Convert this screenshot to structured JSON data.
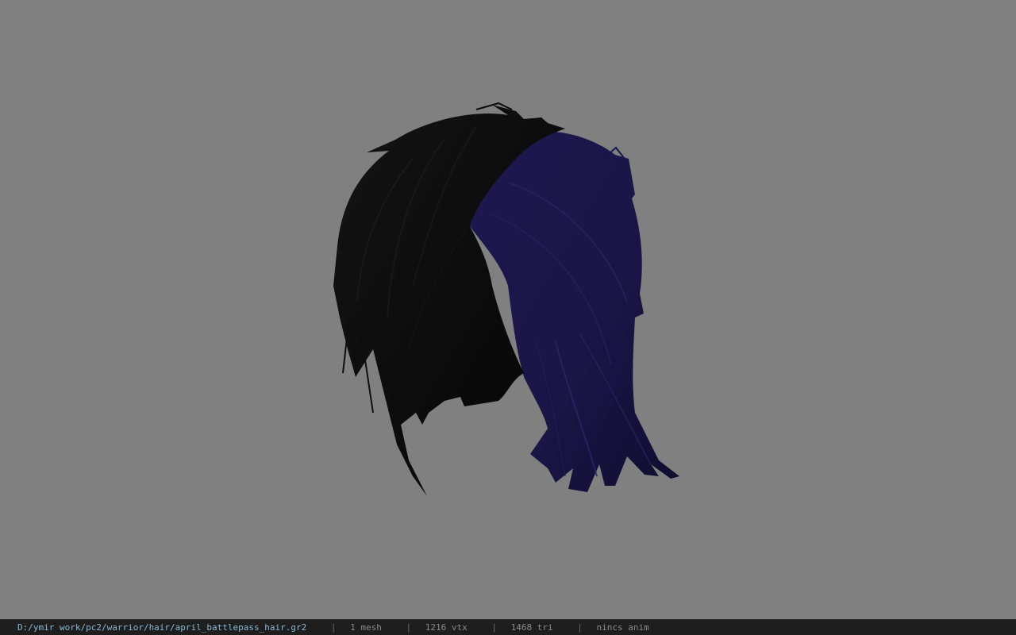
{
  "viewer": {
    "background_color": "#808080",
    "model": {
      "name": "hair-mesh",
      "primary_color": "#0a0a0a",
      "secondary_color": "#1f1a4a"
    }
  },
  "statusbar": {
    "file_path": "D:/ymir work/pc2/warrior/hair/april_battlepass_hair.gr2",
    "separator": "|",
    "mesh_count": "1 mesh",
    "vertex_count": "1216 vtx",
    "triangle_count": "1468 tri",
    "anim_label": "nincs anim"
  }
}
